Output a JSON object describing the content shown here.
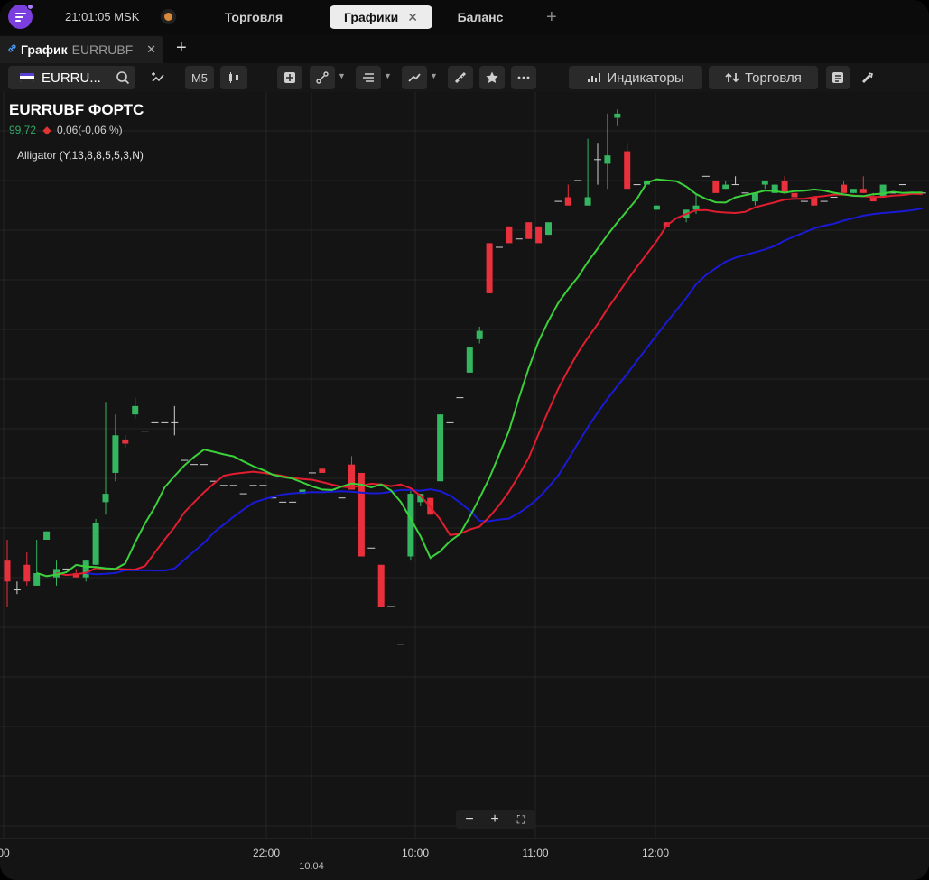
{
  "topbar": {
    "clock": "21:01:05 MSK",
    "tabs": [
      {
        "label": "Торговля",
        "active": false
      },
      {
        "label": "Графики",
        "active": true,
        "close": "✕"
      },
      {
        "label": "Баланс",
        "active": false
      }
    ],
    "add_tab": "+"
  },
  "chart_tabs": {
    "active": {
      "title": "График",
      "symbol": "EURRUBF",
      "close": "✕"
    },
    "add": "+"
  },
  "toolbar": {
    "symbol": "EURRU...",
    "timeframe": "M5",
    "indicators_label": "Индикаторы",
    "trading_label": "Торговля",
    "icons": [
      "search-icon",
      "compare-icon",
      "candles-icon",
      "cross-tool-icon",
      "line-tool-icon",
      "levels-tool-icon",
      "trend-tool-icon",
      "ruler-icon",
      "star-icon",
      "more-icon",
      "indicators-icon",
      "trading-icon",
      "news-icon",
      "alert-icon"
    ]
  },
  "legend": {
    "title": "EURRUBF ФОРТС",
    "last": "99,72",
    "change": "0,06(-0,06 %)",
    "indicator": "Alligator (Y,13,8,8,5,5,3,N)"
  },
  "colors": {
    "up": "#34b55f",
    "down": "#e8313c",
    "jaw": "#1a1ad6",
    "teeth": "#e21d2f",
    "lips": "#3ad13a",
    "grid": "#252525"
  },
  "xaxis": {
    "labels": [
      {
        "text": "00",
        "sub": ""
      },
      {
        "text": "22:00",
        "sub": ""
      },
      {
        "text": "",
        "sub": "10.04"
      },
      {
        "text": "10:00",
        "sub": ""
      },
      {
        "text": "11:00",
        "sub": ""
      },
      {
        "text": "12:00",
        "sub": ""
      }
    ]
  },
  "zoom": {
    "minus": "−",
    "plus": "+",
    "fit": "⛶"
  },
  "chart_data": {
    "type": "candlestick",
    "ylim": [
      98.4,
      100.15
    ],
    "candles": [
      [
        99.05,
        99.0,
        99.1,
        98.94
      ],
      [
        98.98,
        98.98,
        99.0,
        98.97
      ],
      [
        99.04,
        99.0,
        99.07,
        98.99
      ],
      [
        98.99,
        99.02,
        99.1,
        98.99
      ],
      [
        99.1,
        99.12,
        99.12,
        99.1
      ],
      [
        99.01,
        99.03,
        99.05,
        98.99
      ],
      [
        99.03,
        99.03,
        99.03,
        99.03
      ],
      [
        99.02,
        99.01,
        99.03,
        99.01
      ],
      [
        99.01,
        99.05,
        99.05,
        99.0
      ],
      [
        99.04,
        99.14,
        99.15,
        99.04
      ],
      [
        99.19,
        99.21,
        99.43,
        99.16
      ],
      [
        99.26,
        99.35,
        99.4,
        99.24
      ],
      [
        99.34,
        99.33,
        99.35,
        99.32
      ],
      [
        99.4,
        99.42,
        99.44,
        99.39
      ],
      [
        99.36,
        99.36,
        99.36,
        99.36
      ],
      [
        99.38,
        99.38,
        99.38,
        99.38
      ],
      [
        99.38,
        99.38,
        99.38,
        99.38
      ],
      [
        99.38,
        99.38,
        99.42,
        99.35
      ],
      [
        99.29,
        99.29,
        99.29,
        99.29
      ],
      [
        99.28,
        99.28,
        99.28,
        99.28
      ],
      [
        99.28,
        99.28,
        99.28,
        99.28
      ],
      [
        99.24,
        99.24,
        99.24,
        99.24
      ],
      [
        99.23,
        99.23,
        99.23,
        99.23
      ],
      [
        99.23,
        99.23,
        99.23,
        99.23
      ],
      [
        99.21,
        99.21,
        99.21,
        99.21
      ],
      [
        99.23,
        99.23,
        99.23,
        99.23
      ],
      [
        99.23,
        99.23,
        99.23,
        99.23
      ],
      [
        99.2,
        99.2,
        99.2,
        99.2
      ],
      [
        99.19,
        99.19,
        99.19,
        99.19
      ],
      [
        99.19,
        99.19,
        99.19,
        99.19
      ],
      [
        99.21,
        99.22,
        99.22,
        99.21
      ],
      [
        99.26,
        99.26,
        99.26,
        99.26
      ],
      [
        99.27,
        99.26,
        99.27,
        99.26
      ],
      [
        99.22,
        99.22,
        99.22,
        99.22
      ],
      [
        99.2,
        99.2,
        99.2,
        99.2
      ],
      [
        99.28,
        99.22,
        99.3,
        99.22
      ],
      [
        99.26,
        99.06,
        99.26,
        99.06
      ],
      [
        99.08,
        99.08,
        99.08,
        99.08
      ],
      [
        99.04,
        98.94,
        99.04,
        98.94
      ],
      [
        98.94,
        98.94,
        98.94,
        98.94
      ],
      [
        98.85,
        98.85,
        98.85,
        98.85
      ],
      [
        99.06,
        99.21,
        99.22,
        99.05
      ],
      [
        99.19,
        99.21,
        99.21,
        99.18
      ],
      [
        99.2,
        99.16,
        99.2,
        99.16
      ],
      [
        99.24,
        99.4,
        99.4,
        99.24
      ],
      [
        99.38,
        99.38,
        99.38,
        99.38
      ],
      [
        99.44,
        99.44,
        99.44,
        99.44
      ],
      [
        99.5,
        99.56,
        99.56,
        99.5
      ],
      [
        99.58,
        99.6,
        99.61,
        99.57
      ],
      [
        99.81,
        99.69,
        99.81,
        99.69
      ],
      [
        99.8,
        99.8,
        99.8,
        99.8
      ],
      [
        99.85,
        99.81,
        99.85,
        99.81
      ],
      [
        99.82,
        99.82,
        99.82,
        99.82
      ],
      [
        99.86,
        99.82,
        99.86,
        99.82
      ],
      [
        99.85,
        99.81,
        99.85,
        99.81
      ],
      [
        99.83,
        99.86,
        99.86,
        99.83
      ],
      [
        99.91,
        99.91,
        99.91,
        99.91
      ],
      [
        99.92,
        99.9,
        99.95,
        99.9
      ],
      [
        99.96,
        99.96,
        99.96,
        99.96
      ],
      [
        99.9,
        99.92,
        100.06,
        99.9
      ],
      [
        100.01,
        100.01,
        100.05,
        99.95
      ],
      [
        100.0,
        100.02,
        100.12,
        99.94
      ],
      [
        100.11,
        100.12,
        100.13,
        100.09
      ],
      [
        100.03,
        99.94,
        100.05,
        99.94
      ],
      [
        99.95,
        99.95,
        99.95,
        99.95
      ],
      [
        99.95,
        99.96,
        99.95,
        99.95
      ],
      [
        99.89,
        99.9,
        99.9,
        99.89
      ],
      [
        99.86,
        99.85,
        99.86,
        99.85
      ],
      [
        99.87,
        99.87,
        99.87,
        99.87
      ],
      [
        99.87,
        99.89,
        99.89,
        99.86
      ],
      [
        99.89,
        99.9,
        99.93,
        99.88
      ],
      [
        99.97,
        99.97,
        99.97,
        99.97
      ],
      [
        99.96,
        99.93,
        99.96,
        99.93
      ],
      [
        99.94,
        99.95,
        99.96,
        99.94
      ],
      [
        99.95,
        99.95,
        99.97,
        99.95
      ],
      [
        99.93,
        99.93,
        99.93,
        99.93
      ],
      [
        99.91,
        99.93,
        99.93,
        99.9
      ],
      [
        99.95,
        99.96,
        99.96,
        99.94
      ],
      [
        99.93,
        99.95,
        99.95,
        99.93
      ],
      [
        99.96,
        99.93,
        99.97,
        99.93
      ],
      [
        99.93,
        99.92,
        99.93,
        99.92
      ],
      [
        99.91,
        99.91,
        99.91,
        99.91
      ],
      [
        99.92,
        99.9,
        99.92,
        99.9
      ],
      [
        99.91,
        99.91,
        99.91,
        99.91
      ],
      [
        99.92,
        99.92,
        99.92,
        99.92
      ],
      [
        99.95,
        99.93,
        99.96,
        99.93
      ],
      [
        99.93,
        99.94,
        99.94,
        99.93
      ],
      [
        99.94,
        99.93,
        99.97,
        99.93
      ],
      [
        99.92,
        99.91,
        99.93,
        99.91
      ],
      [
        99.92,
        99.95,
        99.95,
        99.92
      ],
      [
        99.93,
        99.93,
        99.93,
        99.93
      ],
      [
        99.95,
        99.95,
        99.95,
        99.95
      ],
      [
        99.93,
        99.93,
        99.93,
        99.93
      ],
      [
        99.93,
        99.93,
        99.93,
        99.93
      ],
      [
        99.95,
        99.97,
        99.97,
        99.95
      ],
      [
        99.97,
        99.96,
        99.97,
        99.96
      ],
      [
        99.97,
        99.97,
        99.97,
        99.97
      ],
      [
        99.95,
        99.96,
        99.97,
        99.95
      ],
      [
        99.95,
        99.94,
        99.95,
        99.94
      ],
      [
        99.94,
        99.94,
        99.94,
        99.94
      ]
    ]
  }
}
